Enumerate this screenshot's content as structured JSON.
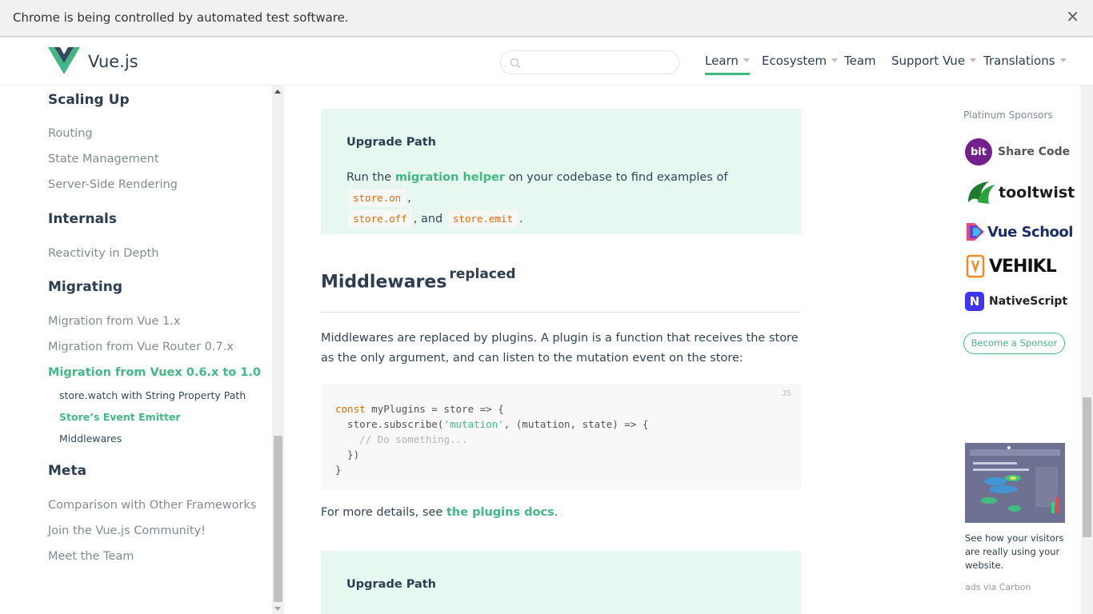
{
  "infobar": {
    "message": "Chrome is being controlled by automated test software.",
    "close": "×"
  },
  "header": {
    "brand": "Vue.js",
    "search_placeholder": "",
    "nav": [
      {
        "label": "Learn",
        "dropdown": true,
        "active": true
      },
      {
        "label": "Ecosystem",
        "dropdown": true
      },
      {
        "label": "Team",
        "dropdown": false
      },
      {
        "label": "Support Vue",
        "dropdown": true
      },
      {
        "label": "Translations",
        "dropdown": true
      }
    ]
  },
  "sidebar": {
    "h_scaling": "Scaling Up",
    "routing": "Routing",
    "state": "State Management",
    "ssr": "Server-Side Rendering",
    "h_internals": "Internals",
    "reactivity": "Reactivity in Depth",
    "h_migrating": "Migrating",
    "mig_vue": "Migration from Vue 1.x",
    "mig_router": "Migration from Vue Router 0.7.x",
    "mig_vuex": "Migration from Vuex 0.6.x to 1.0",
    "sub1": "store.watch with String Property Path",
    "sub2": "Store’s Event Emitter",
    "sub3": "Middlewares",
    "h_meta": "Meta",
    "comparison": "Comparison with Other Frameworks",
    "community": "Join the Vue.js Community!",
    "team": "Meet the Team"
  },
  "main": {
    "tip1": {
      "title": "Upgrade Path",
      "run": "Run the",
      "helper": "migration helper",
      "rest": "on your codebase to find examples of",
      "c1": "store.on",
      "comma": ",",
      "c2": "store.off",
      "and": ", and",
      "c3": "store.emit",
      "period": "."
    },
    "h2": "Middlewares",
    "h2_badge": "replaced",
    "para1": "Middlewares are replaced by plugins. A plugin is a function that receives the store as the only argument, and can listen to the mutation event on the store:",
    "code_lang": "JS",
    "code": {
      "kw_const": "const",
      "line1": " myPlugins = store => {",
      "line2a": "  store.subscribe(",
      "line2s": "'mutation'",
      "line2b": ", (mutation, state) => {",
      "line3": "    // Do something...",
      "line4": "  })",
      "line5": "}"
    },
    "para2_pre": "For more details, see",
    "para2_link": "the plugins docs",
    "para2_post": ".",
    "tip2_title": "Upgrade Path"
  },
  "aside": {
    "platinum": "Platinum Sponsors",
    "sponsors": [
      "Share Code",
      "tooltwist",
      "Vue School",
      "VEHIKL",
      "NativeScript"
    ],
    "bit_badge": "bit",
    "become": "Become a Sponsor",
    "ad_text": "See how your visitors are really using your website.",
    "ad_via": "ads via Carbon"
  },
  "colors": {
    "accent": "#42b983",
    "text": "#2c3e50",
    "tip_bg": "#e7f8f0",
    "code_kw": "#e96900"
  }
}
